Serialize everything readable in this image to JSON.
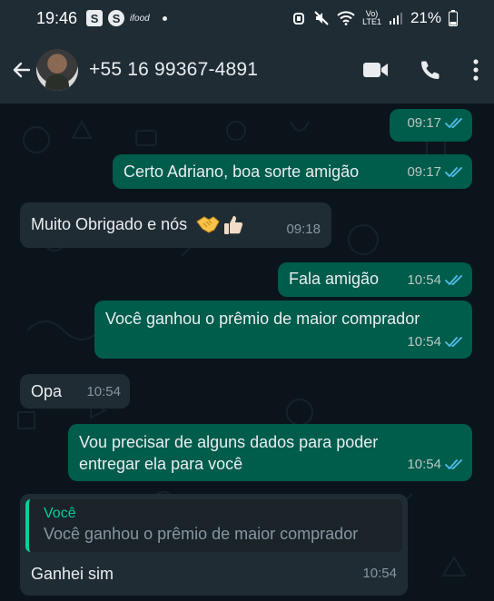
{
  "status_bar": {
    "time": "19:46",
    "badges": [
      "S",
      "S"
    ],
    "small_label": "ifood",
    "network_top": "Vo)",
    "network_bottom": "LTE1",
    "battery": "21%"
  },
  "header": {
    "contact_name": "+55 16 99367-4891",
    "icons": [
      "back-arrow-icon",
      "video-call-icon",
      "voice-call-icon",
      "more-options-icon"
    ]
  },
  "messages": [
    {
      "direction": "out",
      "text": "",
      "time": "09:17",
      "status": "read"
    },
    {
      "direction": "out",
      "text": "Certo Adriano, boa sorte amigão",
      "time": "09:17",
      "status": "read"
    },
    {
      "direction": "in",
      "text": "Muito Obrigado e nós",
      "emojis": [
        "handshake-emoji",
        "thumbs-up-emoji"
      ],
      "time": "09:18"
    },
    {
      "direction": "out",
      "text": "Fala amigão",
      "time": "10:54",
      "status": "read"
    },
    {
      "direction": "out",
      "text": "Você ganhou o prêmio de maior comprador",
      "time": "10:54",
      "status": "read"
    },
    {
      "direction": "in",
      "text": "Opa",
      "time": "10:54"
    },
    {
      "direction": "out",
      "text_line1": "Vou precisar de alguns dados para poder",
      "text_line2": "entregar ela para você",
      "time": "10:54",
      "status": "read"
    },
    {
      "direction": "in",
      "quote_author": "Você",
      "quote_text": "Você ganhou o prêmio de maior comprador",
      "text": "Ganhei sim",
      "time": "10:54"
    }
  ],
  "colors": {
    "outgoing_bubble": "#005c4b",
    "incoming_bubble": "#202c33",
    "header": "#1f2c34",
    "background": "#0b141a",
    "read_tick": "#53bdeb",
    "quote_accent": "#06cf9c"
  }
}
